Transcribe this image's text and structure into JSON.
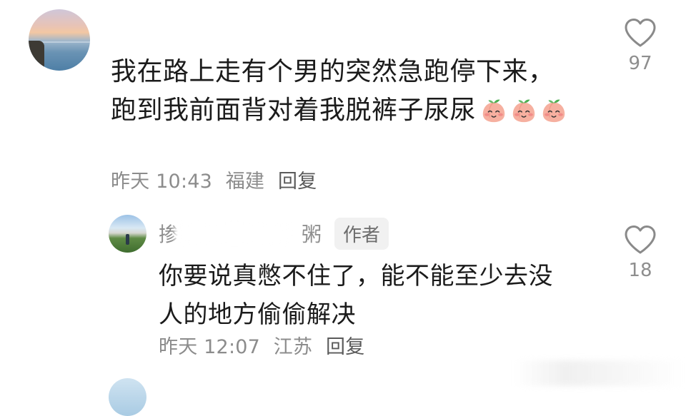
{
  "comment": {
    "text_line1": "我在路上走有个男的突然急跑停下来，",
    "text_line2": "跑到我前面背对着我脱裤子尿尿",
    "emoji_count": 3,
    "emoji_name": "peach-face-emoji",
    "time": "昨天 10:43",
    "location": "福建",
    "reply_label": "回复",
    "likes": "97"
  },
  "reply": {
    "name_start": "掺",
    "name_end": "粥",
    "author_badge": "作者",
    "text_line1": "你要说真憋不住了，能不能至少去没",
    "text_line2": "人的地方偷偷解决",
    "time": "昨天 12:07",
    "location": "江苏",
    "reply_label": "回复",
    "likes": "18"
  },
  "icons": {
    "like": "heart-outline-icon"
  },
  "colors": {
    "meta_gray": "#8c8c8c",
    "text_dark": "#1b1b1b",
    "icon_gray": "#8a8a8a"
  }
}
